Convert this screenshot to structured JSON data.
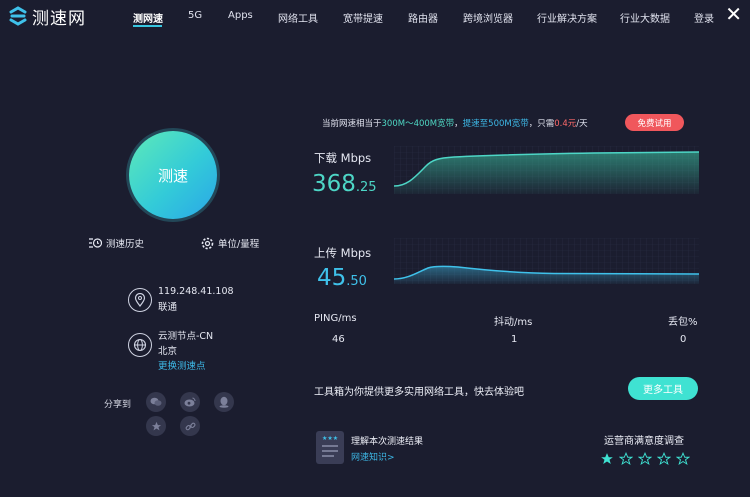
{
  "header": {
    "logo_text": "测速网",
    "nav": [
      {
        "label": "测网速",
        "active": true
      },
      {
        "label": "5G"
      },
      {
        "label": "Apps"
      },
      {
        "label": "网络工具"
      },
      {
        "label": "宽带提速"
      },
      {
        "label": "路由器"
      },
      {
        "label": "跨境浏览器"
      },
      {
        "label": "行业解决方案"
      },
      {
        "label": "行业大数据"
      }
    ],
    "login": "登录",
    "close": "✕"
  },
  "left": {
    "test_button": "测速",
    "history": "测速历史",
    "units": "单位/量程",
    "ip": "119.248.41.108",
    "isp": "联通",
    "node": "云测节点-CN",
    "city": "北京",
    "change_node": "更换测速点",
    "share_label": "分享到"
  },
  "promo": {
    "p1": "当前网速相当于",
    "range": "300M～400M宽带",
    "p2": "，",
    "upgrade": "提速至500M宽带",
    "p3": "，只需",
    "price": "0.4元",
    "p4": "/天",
    "trial_button": "免费试用"
  },
  "download": {
    "label": "下载 Mbps",
    "int": "368",
    "dec": ".25"
  },
  "upload": {
    "label": "上传 Mbps",
    "int": "45",
    "dec": ".50"
  },
  "stats": {
    "ping_label": "PING/ms",
    "ping": "46",
    "jitter_label": "抖动/ms",
    "jitter": "1",
    "loss_label": "丢包%",
    "loss": "0"
  },
  "tools": {
    "text": "工具箱为你提供更多实用网络工具，快去体验吧",
    "button": "更多工具"
  },
  "result": {
    "title": "理解本次测速结果",
    "link": "网速知识>"
  },
  "survey": {
    "title": "运营商满意度调查",
    "rating": 1,
    "max": 5
  },
  "colors": {
    "accent": "#3fe2d2",
    "bg": "#1b1d2f",
    "download": "#4dd6c6",
    "upload": "#3fc1ea",
    "promo_button": "#f0575c"
  }
}
